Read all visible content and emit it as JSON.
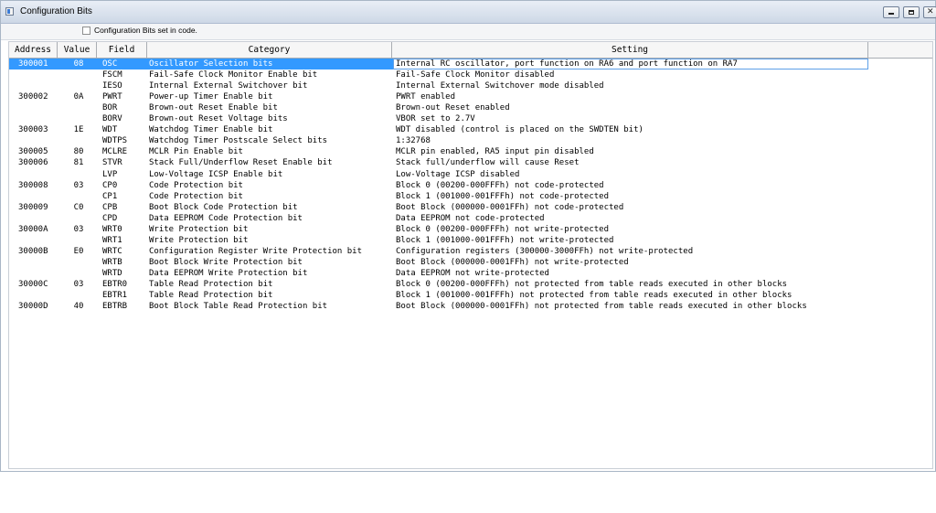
{
  "window": {
    "title": "Configuration Bits"
  },
  "toolbar": {
    "checkbox_label": "Configuration Bits set in code.",
    "checkbox_checked": false
  },
  "columns": [
    {
      "label": "Address"
    },
    {
      "label": "Value"
    },
    {
      "label": "Field"
    },
    {
      "label": "Category"
    },
    {
      "label": "Setting"
    }
  ],
  "rows": [
    {
      "address": "300001",
      "value": "08",
      "field": "OSC",
      "category": "Oscillator Selection bits",
      "setting": "Internal RC oscillator, port function on RA6 and port function on RA7",
      "selected": true
    },
    {
      "address": "",
      "value": "",
      "field": "FSCM",
      "category": "Fail-Safe Clock Monitor Enable bit",
      "setting": "Fail-Safe Clock Monitor disabled"
    },
    {
      "address": "",
      "value": "",
      "field": "IESO",
      "category": "Internal External Switchover bit",
      "setting": "Internal External Switchover mode disabled"
    },
    {
      "address": "300002",
      "value": "0A",
      "field": "PWRT",
      "category": "Power-up Timer Enable bit",
      "setting": "PWRT enabled"
    },
    {
      "address": "",
      "value": "",
      "field": "BOR",
      "category": "Brown-out Reset Enable bit",
      "setting": "Brown-out Reset enabled"
    },
    {
      "address": "",
      "value": "",
      "field": "BORV",
      "category": "Brown-out Reset Voltage bits",
      "setting": "VBOR set to 2.7V"
    },
    {
      "address": "300003",
      "value": "1E",
      "field": "WDT",
      "category": "Watchdog Timer Enable bit",
      "setting": "WDT disabled (control is placed on the SWDTEN bit)"
    },
    {
      "address": "",
      "value": "",
      "field": "WDTPS",
      "category": "Watchdog Timer Postscale Select bits",
      "setting": "1:32768"
    },
    {
      "address": "300005",
      "value": "80",
      "field": "MCLRE",
      "category": "MCLR Pin Enable bit",
      "setting": "MCLR pin enabled, RA5 input pin disabled"
    },
    {
      "address": "300006",
      "value": "81",
      "field": "STVR",
      "category": "Stack Full/Underflow Reset Enable bit",
      "setting": "Stack full/underflow will cause Reset"
    },
    {
      "address": "",
      "value": "",
      "field": "LVP",
      "category": "Low-Voltage ICSP Enable bit",
      "setting": "Low-Voltage ICSP disabled"
    },
    {
      "address": "300008",
      "value": "03",
      "field": "CP0",
      "category": "Code Protection bit",
      "setting": "Block 0 (00200-000FFFh) not code-protected"
    },
    {
      "address": "",
      "value": "",
      "field": "CP1",
      "category": "Code Protection bit",
      "setting": "Block 1 (001000-001FFFh) not code-protected"
    },
    {
      "address": "300009",
      "value": "C0",
      "field": "CPB",
      "category": "Boot Block Code Protection bit",
      "setting": "Boot Block (000000-0001FFh) not code-protected"
    },
    {
      "address": "",
      "value": "",
      "field": "CPD",
      "category": "Data EEPROM Code Protection bit",
      "setting": "Data EEPROM not code-protected"
    },
    {
      "address": "30000A",
      "value": "03",
      "field": "WRT0",
      "category": "Write Protection bit",
      "setting": "Block 0 (00200-000FFFh) not write-protected"
    },
    {
      "address": "",
      "value": "",
      "field": "WRT1",
      "category": "Write Protection bit",
      "setting": "Block 1 (001000-001FFFh) not write-protected"
    },
    {
      "address": "30000B",
      "value": "E0",
      "field": "WRTC",
      "category": "Configuration Register Write Protection bit",
      "setting": "Configuration registers (300000-3000FFh) not write-protected"
    },
    {
      "address": "",
      "value": "",
      "field": "WRTB",
      "category": "Boot Block Write Protection bit",
      "setting": "Boot Block (000000-0001FFh) not write-protected"
    },
    {
      "address": "",
      "value": "",
      "field": "WRTD",
      "category": "Data EEPROM Write Protection bit",
      "setting": "Data EEPROM not write-protected"
    },
    {
      "address": "30000C",
      "value": "03",
      "field": "EBTR0",
      "category": "Table Read Protection bit",
      "setting": "Block 0 (00200-000FFFh) not protected from table reads executed in other blocks"
    },
    {
      "address": "",
      "value": "",
      "field": "EBTR1",
      "category": "Table Read Protection bit",
      "setting": "Block 1 (001000-001FFFh) not protected from table reads executed in other blocks"
    },
    {
      "address": "30000D",
      "value": "40",
      "field": "EBTRB",
      "category": "Boot Block Table Read Protection bit",
      "setting": "Boot Block (000000-0001FFh) not protected from table reads executed in other blocks"
    }
  ],
  "colors": {
    "selection": "#3399ff",
    "title_bar": "#dfe6ef",
    "header": "#f6f6f6"
  },
  "icons": {
    "app": "window-icon",
    "minimize": "minimize-icon",
    "maximize": "maximize-icon",
    "close": "close-icon"
  }
}
